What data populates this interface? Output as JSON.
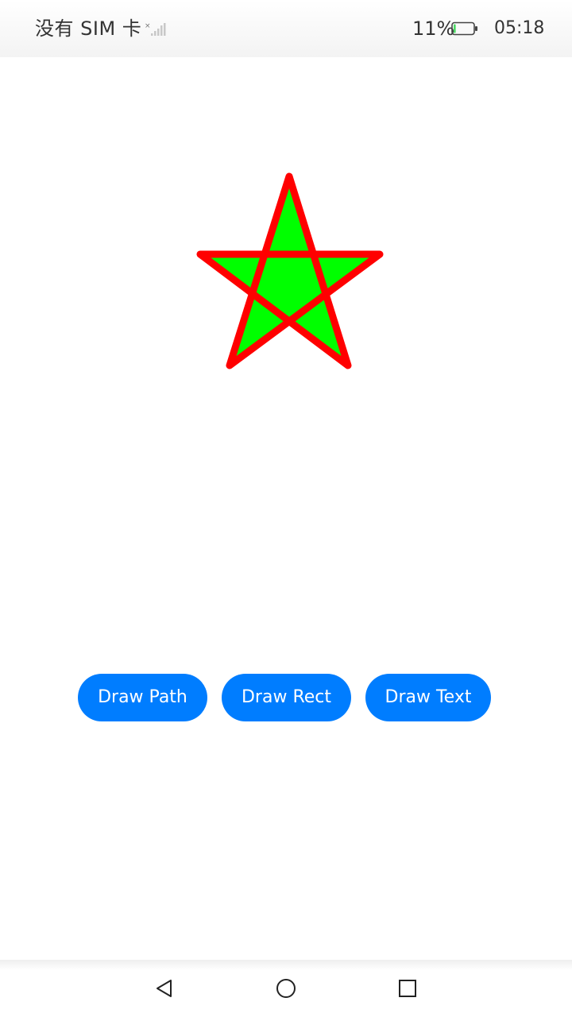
{
  "status_bar": {
    "carrier": "没有 SIM 卡",
    "battery_percent": "11%",
    "time": "05:18",
    "battery_level": 0.11,
    "icons": [
      "signal-icon",
      "battery-icon"
    ]
  },
  "canvas": {
    "shape": "star",
    "stroke_color": "#ff0000",
    "fill_color": "#00ff00"
  },
  "buttons": {
    "draw_path": "Draw Path",
    "draw_rect": "Draw Rect",
    "draw_text": "Draw Text",
    "color": "#007dff"
  },
  "nav_bar": {
    "icons": [
      "back-icon",
      "home-icon",
      "recents-icon"
    ]
  }
}
